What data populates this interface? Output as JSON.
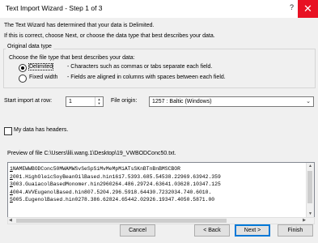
{
  "window": {
    "title": "Text Import Wizard - Step 1 of 3",
    "help": "?",
    "close": "✕"
  },
  "intro": {
    "line1": "The Text Wizard has determined that your data is Delimited.",
    "line2": "If this is correct, choose Next, or choose the data type that best describes your data."
  },
  "original_data_type": {
    "group_label": "Original data type",
    "prompt": "Choose the file type that best describes your data:",
    "options": [
      {
        "label": "Delimited",
        "desc": "- Characters such as commas or tabs separate each field.",
        "selected": true
      },
      {
        "label": "Fixed width",
        "desc": "- Fields are aligned in columns with spaces between each field.",
        "selected": false
      }
    ]
  },
  "start_row": {
    "label": "Start import at row:",
    "value": "1"
  },
  "file_origin": {
    "label": "File origin:",
    "value": "1257 : Baltic (Windows)"
  },
  "headers": {
    "label": "My data has headers.",
    "checked": false
  },
  "preview": {
    "label": "Preview of file C:\\Users\\lili.wang.1\\Desktop\\19_VWBODConc50.txt.",
    "lines": [
      {
        "num": "1",
        "text": "NAMEWWBODConc50MWAMWSvSeSpSiMvMeMpMiATsSKnBTnBnBMSCBOR"
      },
      {
        "num": "2",
        "text": "001.HighOleicSoyBeanOilBased.hin1617.5393.685.54538.22969.63942.359"
      },
      {
        "num": "3",
        "text": "003.GuaiacolBasedMonomer.hin2960264.486.29724.63641.03628.10347.125"
      },
      {
        "num": "4",
        "text": "004.AVVEugenolBased.hin807.5204.296.5918.64430.7232034.740.6010."
      },
      {
        "num": "5",
        "text": "005.EugenolBased.hin0278.386.62824.65442.02926.19347.4050.5871.00"
      }
    ]
  },
  "buttons": {
    "cancel": "Cancel",
    "back": "< Back",
    "next": "Next >",
    "finish": "Finish"
  }
}
